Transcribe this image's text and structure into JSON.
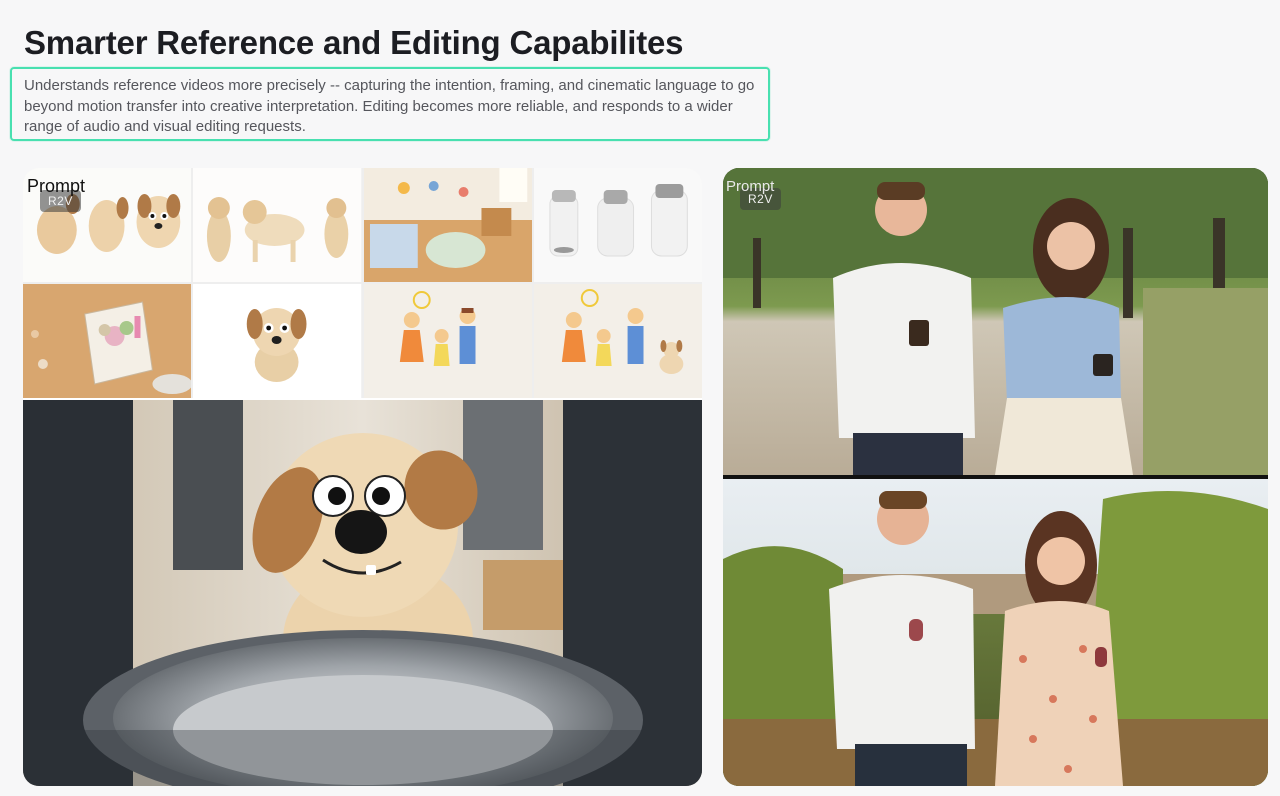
{
  "section": {
    "title": "Smarter Reference and Editing Capabilites",
    "description": "Understands reference videos more precisely -- capturing the intention, framing, and cinematic language to go beyond motion transfer into creative interpretation. Editing becomes more reliable, and responds to a wider range of audio and visual editing requests."
  },
  "left_card": {
    "prompt_label": "Prompt",
    "badge": "R2V",
    "thumbnails": [
      {
        "subject": "paper-dog-cutouts"
      },
      {
        "subject": "puppy-poses"
      },
      {
        "subject": "kids-room"
      },
      {
        "subject": "pet-feeders"
      },
      {
        "subject": "craft-box"
      },
      {
        "subject": "paper-dog"
      },
      {
        "subject": "family-drawing"
      },
      {
        "subject": "family-drawing-with-dog"
      }
    ],
    "main_scene": "paper-dog-above-bowl"
  },
  "right_card": {
    "prompt_label": "Prompt",
    "badge": "R2V",
    "top_scene": "couple-walking-park-coffee",
    "bottom_scene": "couple-vineyard-wine"
  },
  "colors": {
    "highlight_border": "#48e0b0",
    "background": "#f7f7f8",
    "title": "#1c1d22",
    "description": "#55565c"
  }
}
